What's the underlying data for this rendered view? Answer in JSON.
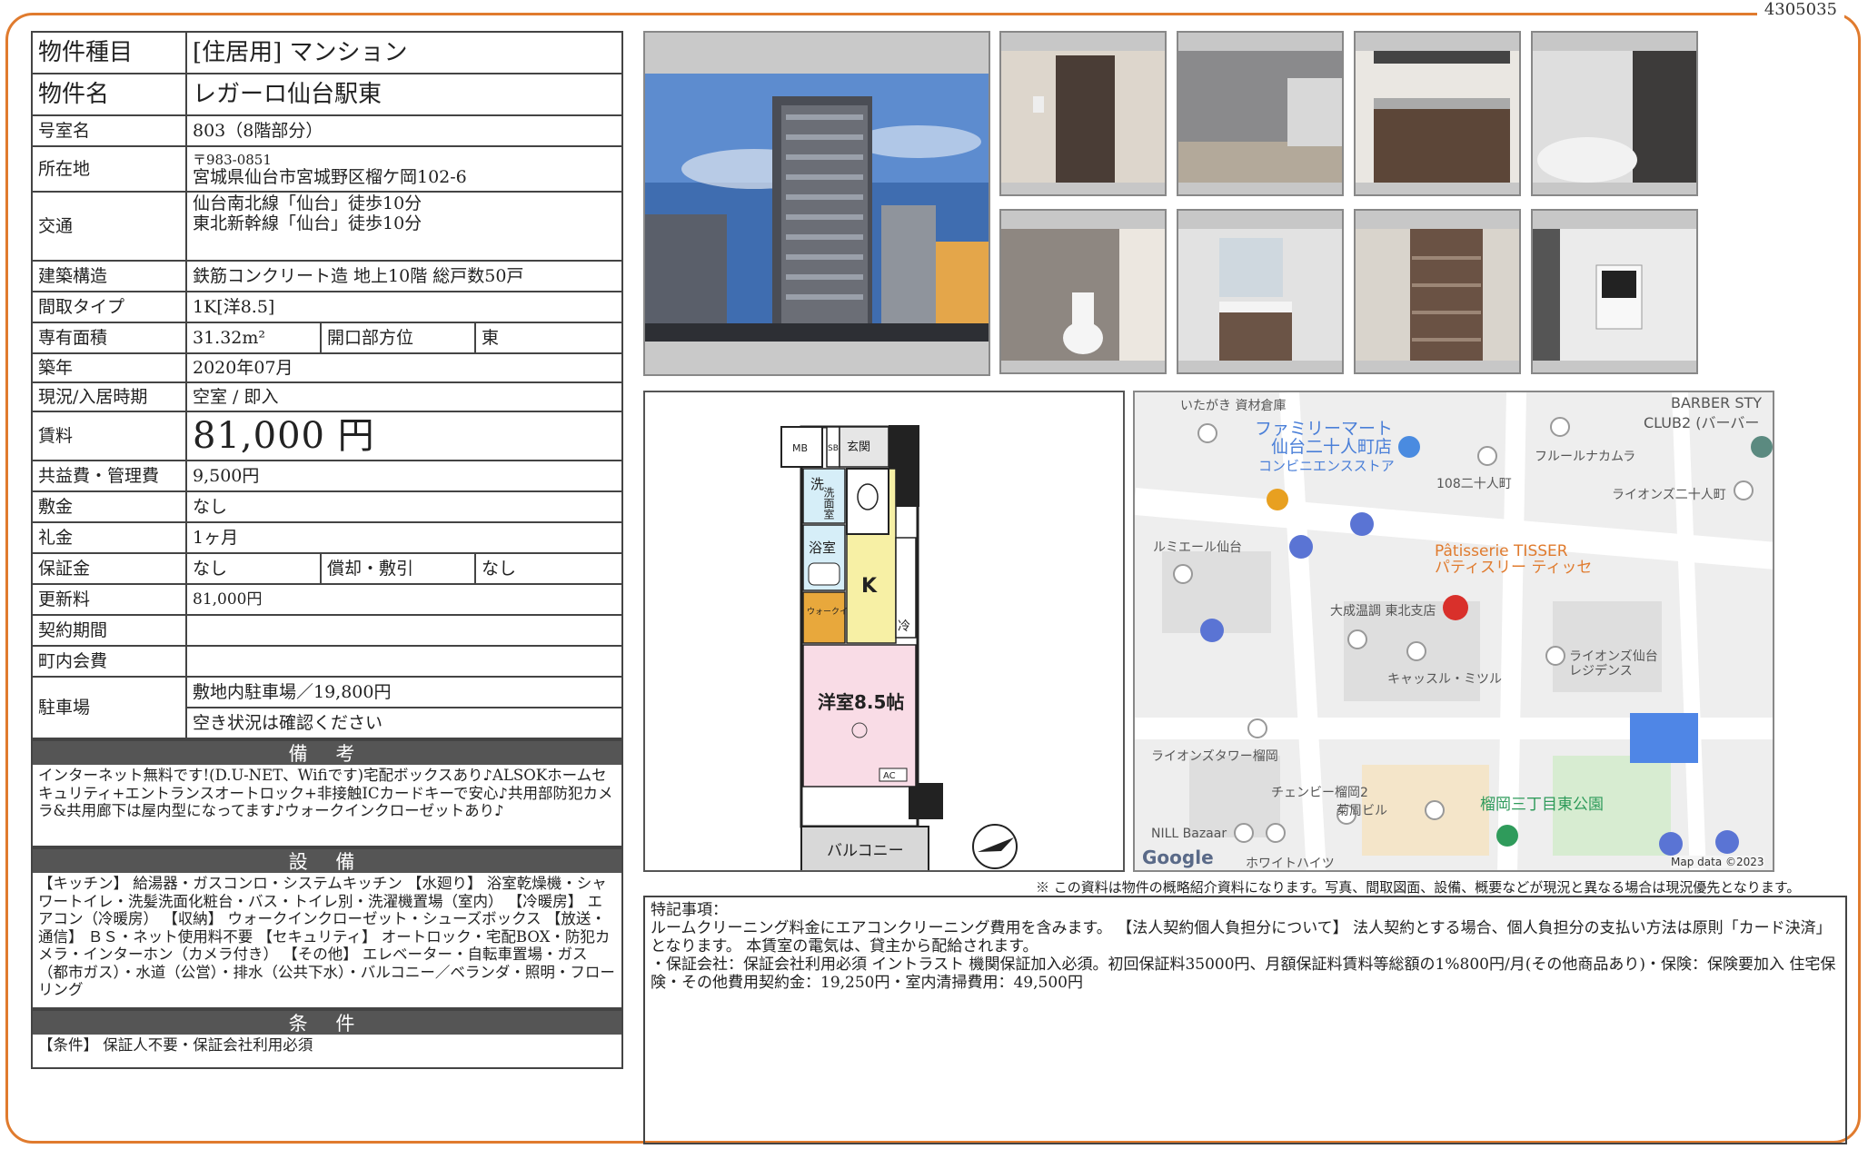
{
  "doc_id": "4305035",
  "property": {
    "type_label": "物件種目",
    "type_value": "[住居用] マンション",
    "name_label": "物件名",
    "name_value": "レガーロ仙台駅東",
    "room_label": "号室名",
    "room_value": "803（8階部分）",
    "address_label": "所在地",
    "postal": "〒983-0851",
    "address": "宮城県仙台市宮城野区榴ケ岡102-6",
    "transport_label": "交通",
    "transport_1": "仙台南北線「仙台」徒歩10分",
    "transport_2": "東北新幹線「仙台」徒歩10分",
    "structure_label": "建築構造",
    "structure_value": "鉄筋コンクリート造 地上10階 総戸数50戸",
    "layout_label": "間取タイプ",
    "layout_value": "1K[洋8.5]",
    "area_label": "専有面積",
    "area_value": "31.32m²",
    "direction_label": "開口部方位",
    "direction_value": "東",
    "built_label": "築年",
    "built_value": "2020年07月",
    "status_label": "現況/入居時期",
    "status_value": "空室 / 即入",
    "rent_label": "賃料",
    "rent_value": "81,000 円",
    "fee_label": "共益費・管理費",
    "fee_value": "9,500円",
    "deposit_label": "敷金",
    "deposit_value": "なし",
    "keymoney_label": "礼金",
    "keymoney_value": "1ヶ月",
    "guarantee_label": "保証金",
    "guarantee_value": "なし",
    "amort_label": "償却・敷引",
    "amort_value": "なし",
    "renewal_label": "更新料",
    "renewal_value": "81,000円",
    "contract_label": "契約期間",
    "contract_value": "",
    "town_label": "町内会費",
    "town_value": "",
    "parking_label": "駐車場",
    "parking_value_1": "敷地内駐車場／19,800円",
    "parking_value_2": "空き状況は確認ください"
  },
  "remarks": {
    "title": "備 考",
    "body": "インターネット無料です!(D.U-NET、Wifiです)宅配ボックスあり♪ALSOKホームセキュリティ+エントランスオートロック+非接触ICカードキーで安心♪共用部防犯カメラ&共用廊下は屋内型になってます♪ウォークインクローゼットあり♪"
  },
  "facilities": {
    "title": "設 備",
    "body": "【キッチン】 給湯器・ガスコンロ・システムキッチン 【水廻り】 浴室乾燥機・シャワートイレ・洗髪洗面化粧台・バス・トイレ別・洗濯機置場（室内） 【冷暖房】 エアコン（冷暖房） 【収納】 ウォークインクローゼット・シューズボックス 【放送・通信】 ＢＳ・ネット使用料不要 【セキュリティ】 オートロック・宅配BOX・防犯カメラ・インターホン（カメラ付き） 【その他】 エレベーター・自転車置場・ガス（都市ガス）・水道（公営）・排水（公共下水）・バルコニー／ベランダ・照明・フローリング"
  },
  "conditions": {
    "title": "条 件",
    "body": "【条件】 保証人不要・保証会社利用必須"
  },
  "floorplan": {
    "room_label": "洋室8.5帖",
    "kitchen": "K",
    "balcony": "バルコニー",
    "bath": "浴室",
    "wash": "洗面室",
    "wash_symbol": "洗",
    "entrance": "玄関",
    "mb": "MB",
    "sb": "SB",
    "walkin": "ウォークイン\nクローゼット",
    "fridge": "冷",
    "ac": "AC"
  },
  "map": {
    "labels": [
      "いたがき 資材倉庫",
      "ファミリーマート",
      "仙台二十人町店",
      "コンビニエンスストア",
      "108二十人町",
      "フルールナカムラ",
      "BARBER STY",
      "CLUB2 (バーバー",
      "ライオンズ二十人町",
      "ルミエール仙台",
      "Pâtisserie TISSER",
      "パティスリー ティッセ",
      "大成温調 東北支店",
      "キャッスル・ミツル",
      "ライオンズ仙台",
      "レジデンス",
      "ライオンズタワー榴岡",
      "チェンビー榴岡2",
      "菊周ビル",
      "榴岡三丁目東公園",
      "NILL Bazaar",
      "ホワイトハイツ",
      "Google",
      "Map data ©2023"
    ]
  },
  "disclaimer": "※ この資料は物件の概略紹介資料になります。写真、間取図面、設備、概要などが現況と異なる場合は現況優先となります。",
  "notes": "特記事項：\nルームクリーニング料金にエアコンクリーニング費用を含みます。 【法人契約個人負担分について】 法人契約とする場合、個人負担分の支払い方法は原則「カード決済」となります。 本賃室の電気は、貸主から配給されます。\n・保証会社：保証会社利用必須 イントラスト 機関保証加入必須。初回保証料35000円、月額保証料賃料等総額の1%800円/月(その他商品あり)・保険：保険要加入 住宅保険・その他費用契約金：19,250円・室内清掃費用：49,500円"
}
